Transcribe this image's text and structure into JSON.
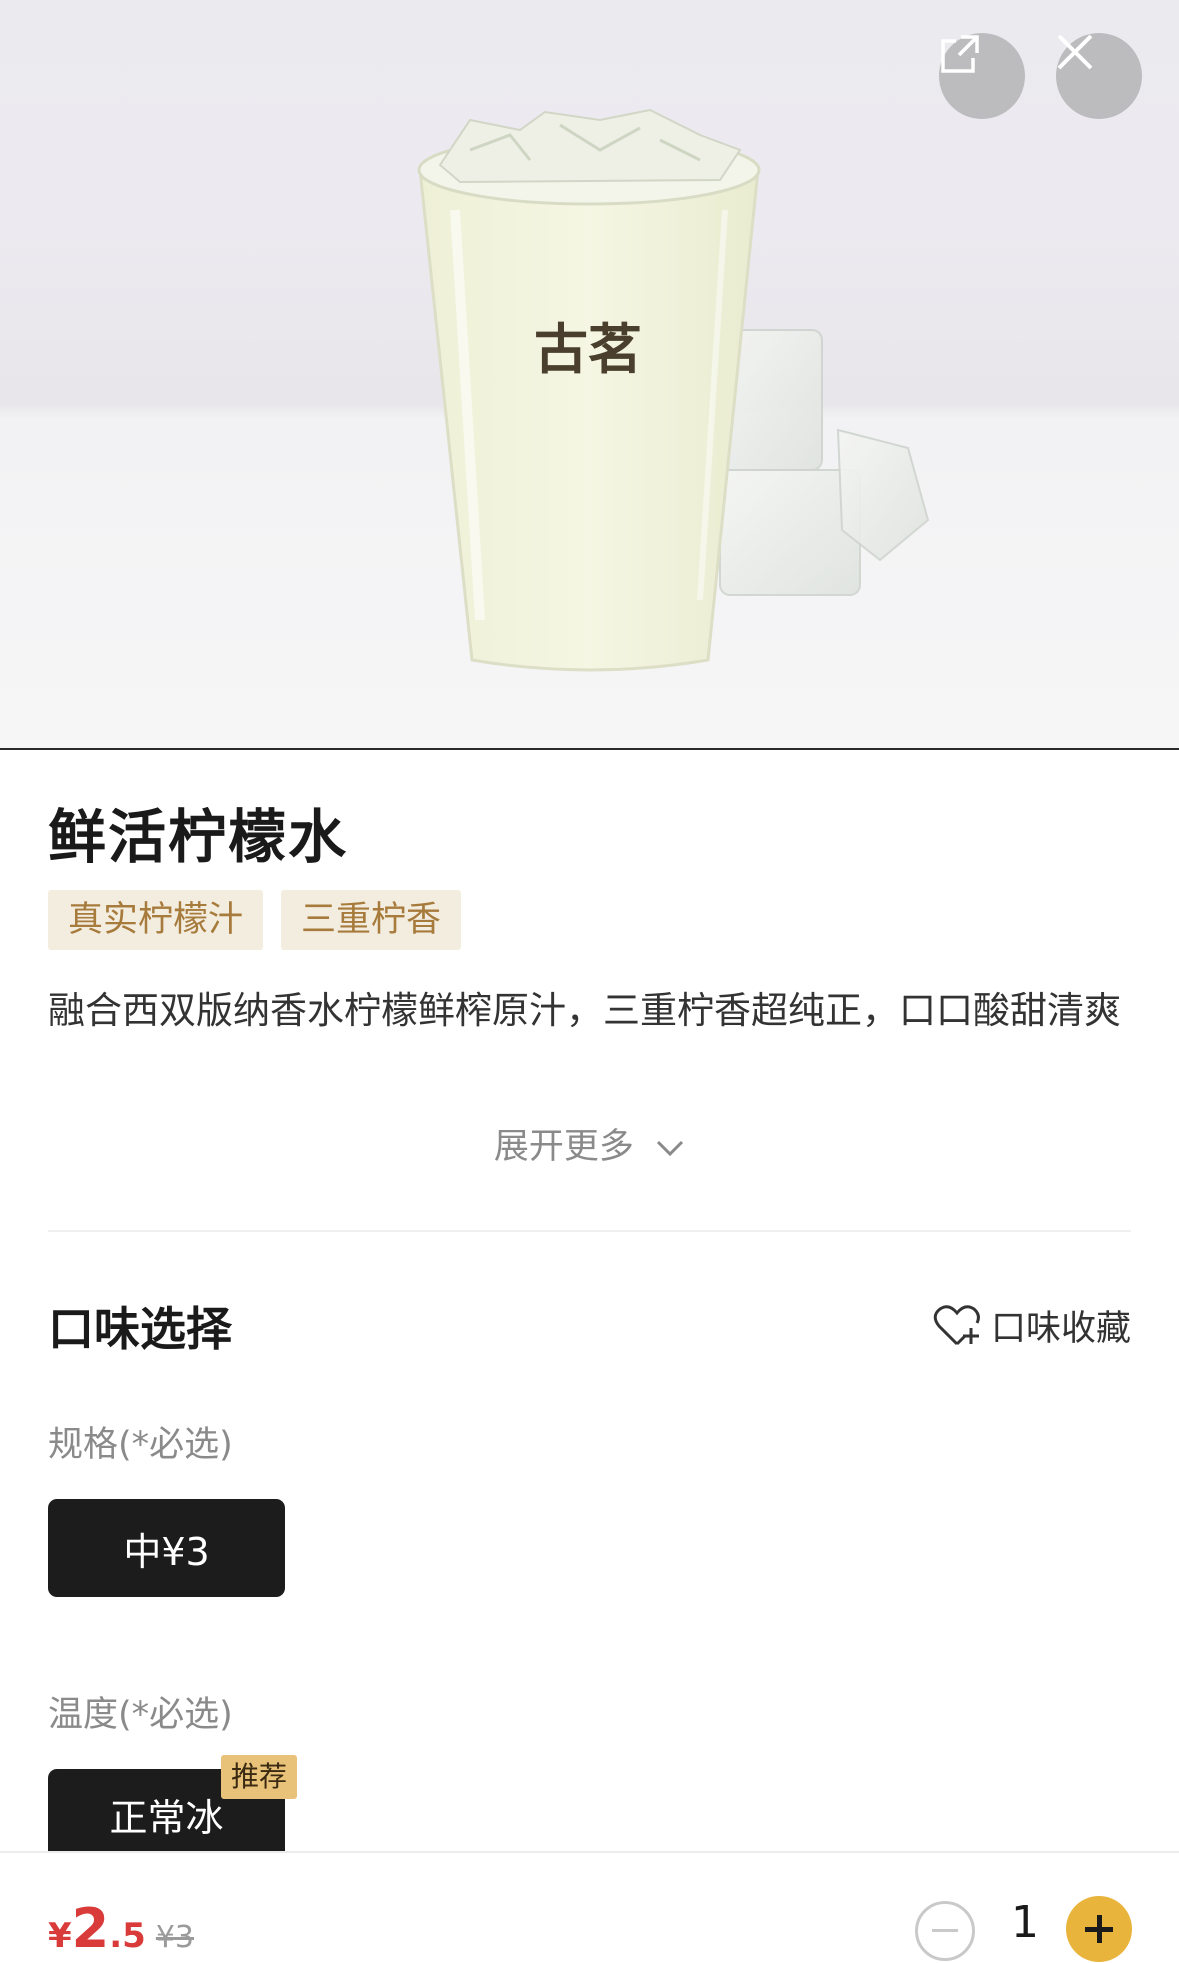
{
  "hero": {
    "cup_logo": "古茗",
    "share_icon": "share-icon",
    "close_icon": "close-icon"
  },
  "product": {
    "name": "鲜活柠檬水",
    "tags": [
      "真实柠檬汁",
      "三重柠香"
    ],
    "description": "融合西双版纳香水柠檬鲜榨原汁，三重柠香超纯正，口口酸甜清爽",
    "expand_label": "展开更多"
  },
  "options": {
    "section_title": "口味选择",
    "favorite_label": "口味收藏",
    "size": {
      "label": "规格(*必选)",
      "selected": "中¥3"
    },
    "temperature": {
      "label": "温度(*必选)",
      "selected": "正常冰",
      "badge": "推荐"
    }
  },
  "cart": {
    "price_currency": "¥",
    "price_integer": "2",
    "price_decimal": ".5",
    "original_price": "¥3",
    "quantity": "1"
  },
  "colors": {
    "accent": "#e8b43b",
    "price": "#d93a3a",
    "tag_bg": "#f3ede0",
    "tag_text": "#a77b3c",
    "selected_option": "#1c1c1c"
  }
}
